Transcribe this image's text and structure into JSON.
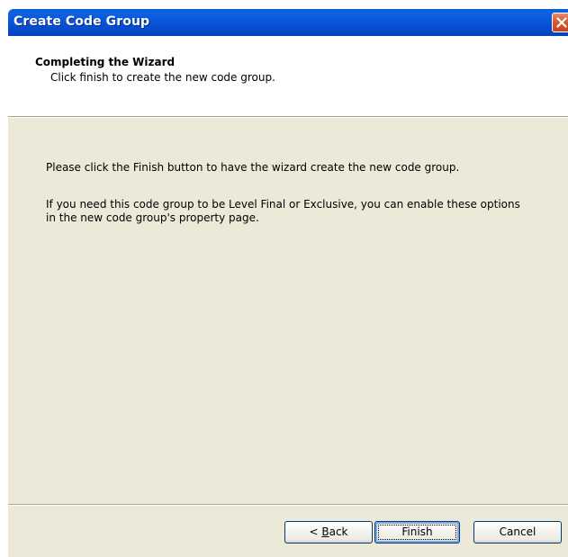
{
  "window": {
    "title": "Create Code Group",
    "close_icon": "close-x-icon"
  },
  "header": {
    "title": "Completing the Wizard",
    "subtitle": "Click finish to create the new code group."
  },
  "body": {
    "paragraph_1": "Please click the Finish button to have the wizard create the new code group.",
    "paragraph_2": "If you need this code group to be Level Final or Exclusive, you can enable these options in the new code group's property page."
  },
  "buttons": {
    "back_prefix": "< ",
    "back_accel": "B",
    "back_rest": "ack",
    "finish": "Finish",
    "cancel": "Cancel"
  },
  "colors": {
    "titlebar": "#0755d8",
    "body_background": "#ece9d8",
    "close_button": "#d95b36"
  }
}
